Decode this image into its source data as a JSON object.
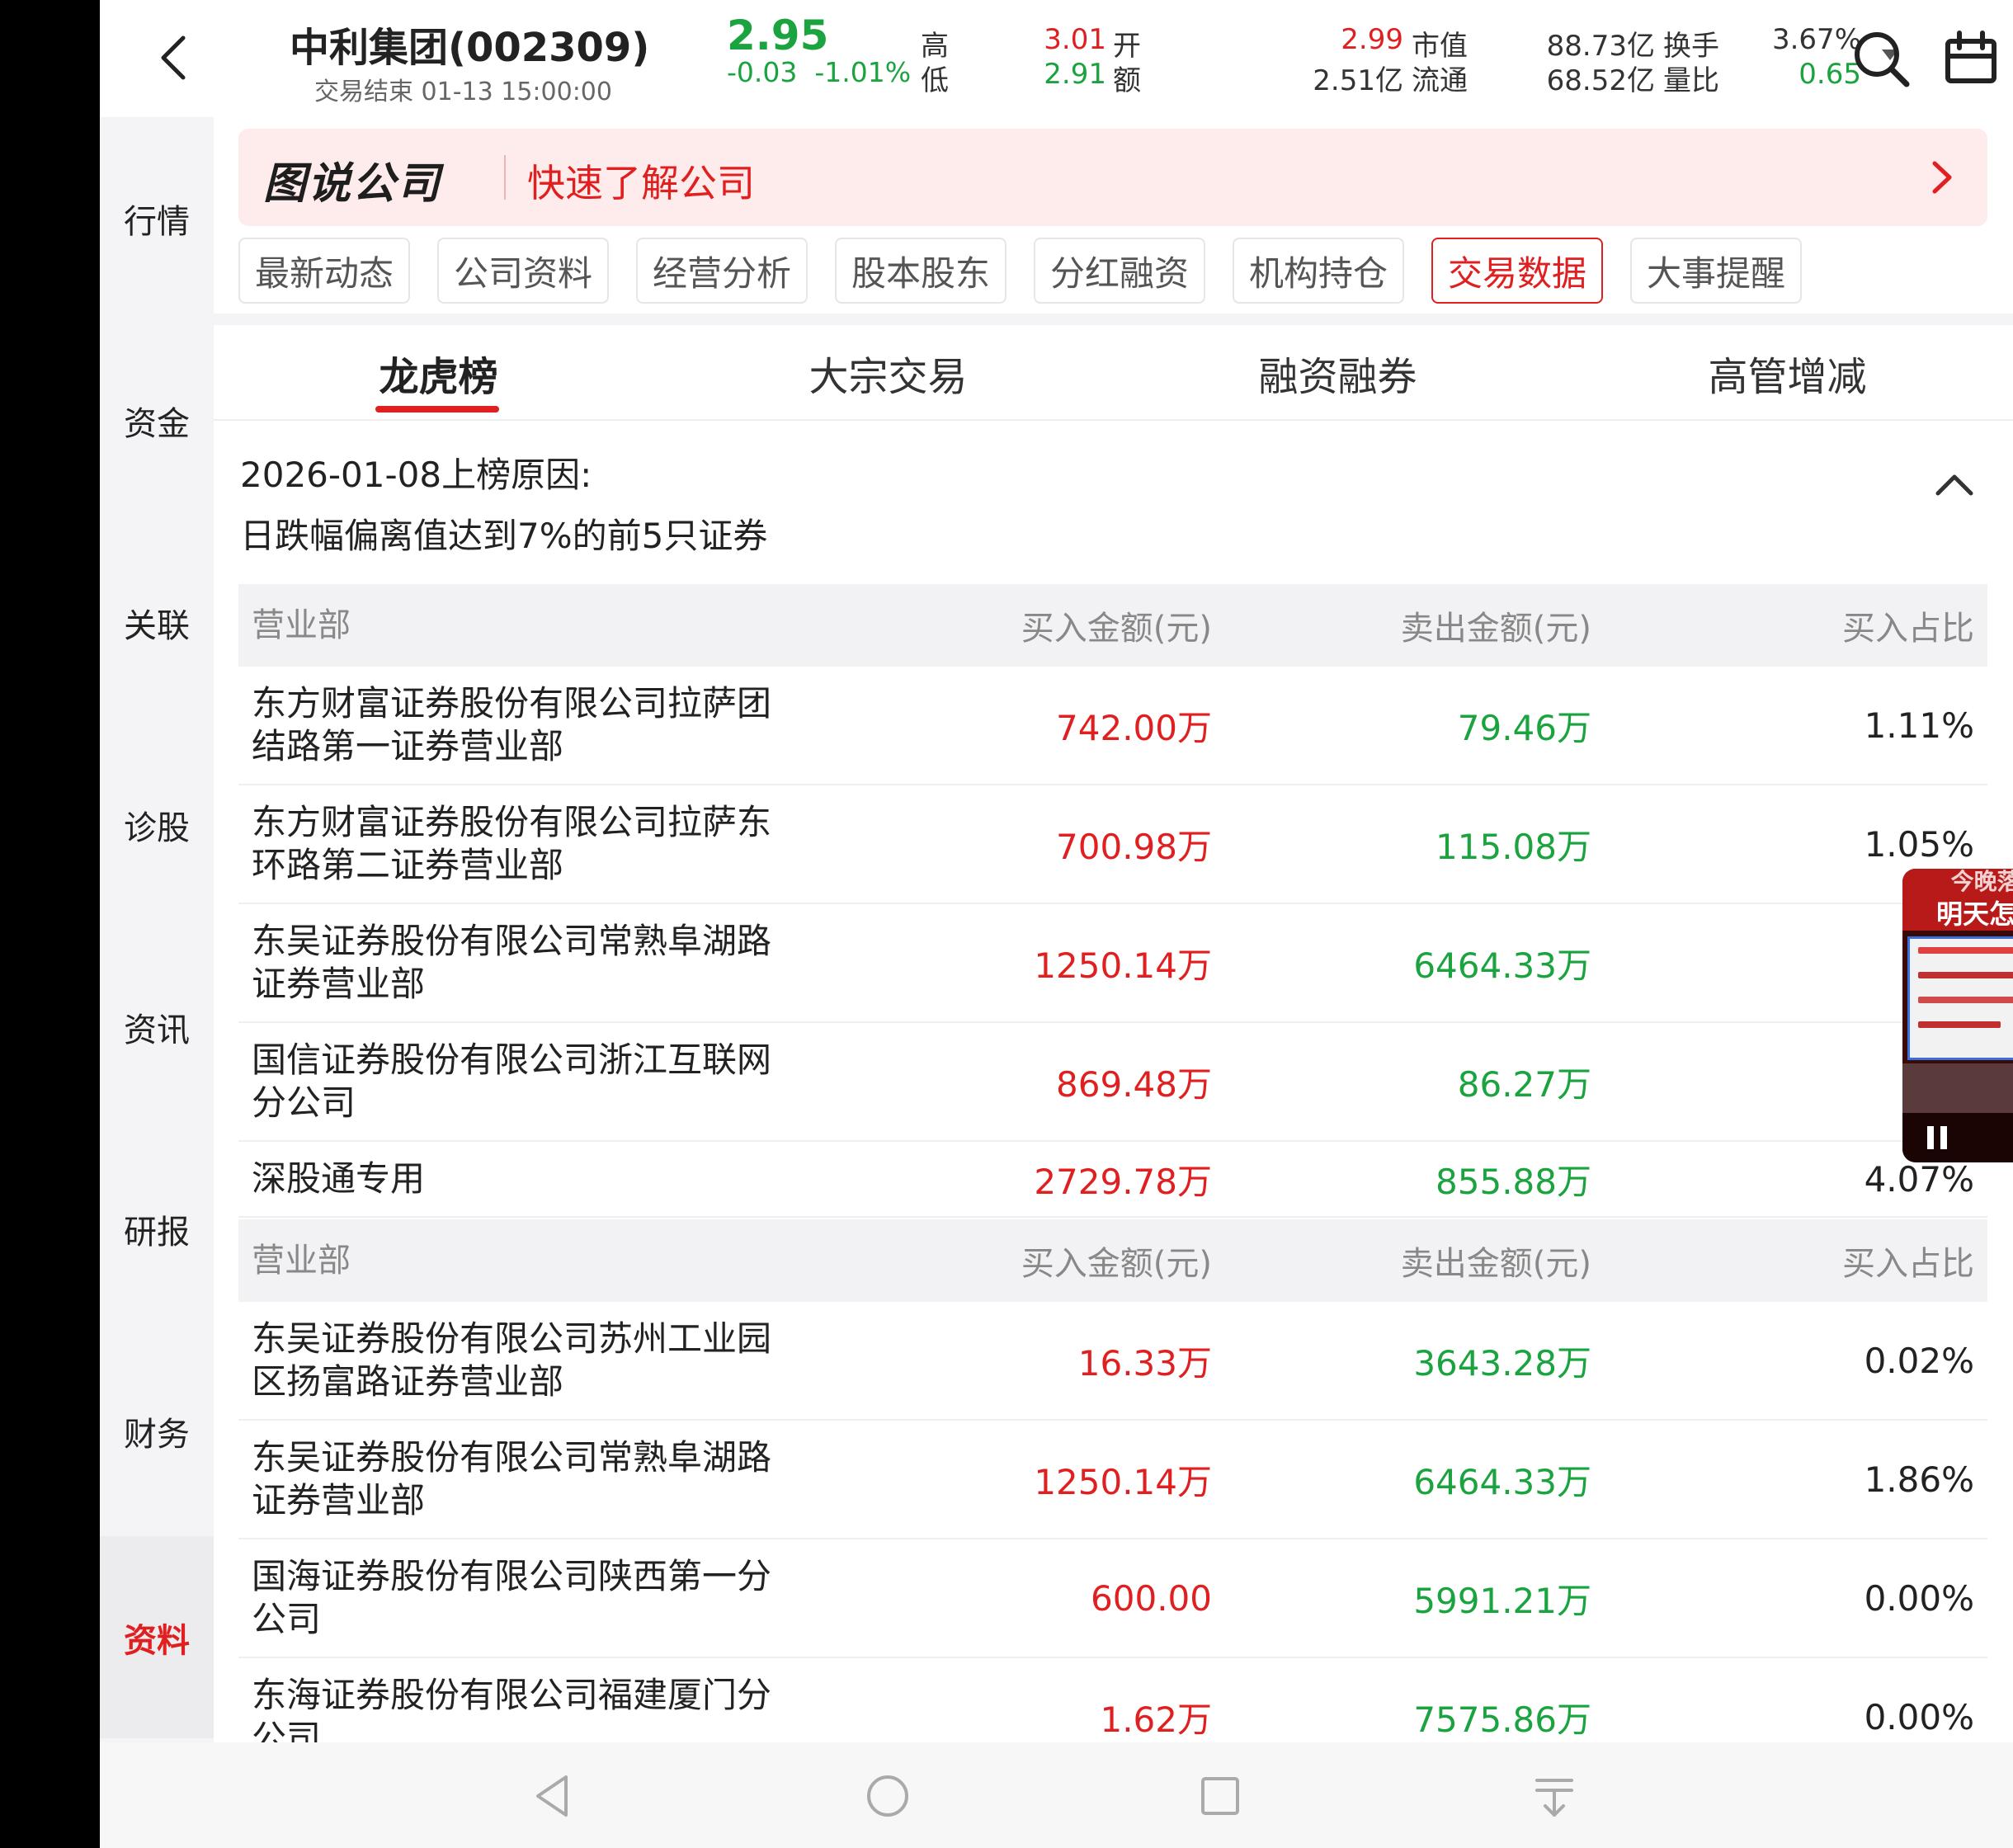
{
  "header": {
    "stock_name": "中利集团(002309)",
    "status": "交易结束 01-13 15:00:00",
    "price": "2.95",
    "change": "-0.03",
    "change_pct": "-1.01%",
    "stats": {
      "high_label": "高",
      "high": "3.01",
      "low_label": "低",
      "low": "2.91",
      "open_label": "开",
      "open": "2.99",
      "amount_label": "额",
      "amount": "2.51亿",
      "mktcap_label": "市值",
      "mktcap": "88.73亿",
      "float_label": "流通",
      "float": "68.52亿",
      "turnover_label": "换手",
      "turnover": "3.67%",
      "volratio_label": "量比",
      "volratio": "0.65"
    }
  },
  "left_nav": [
    {
      "label": "行情"
    },
    {
      "label": "资金"
    },
    {
      "label": "关联"
    },
    {
      "label": "诊股"
    },
    {
      "label": "资讯"
    },
    {
      "label": "研报"
    },
    {
      "label": "财务"
    },
    {
      "label": "资料"
    }
  ],
  "banner": {
    "logo": "图说公司",
    "text": "快速了解公司"
  },
  "category_tabs": [
    {
      "label": "最新动态"
    },
    {
      "label": "公司资料"
    },
    {
      "label": "经营分析"
    },
    {
      "label": "股本股东"
    },
    {
      "label": "分红融资"
    },
    {
      "label": "机构持仓"
    },
    {
      "label": "交易数据"
    },
    {
      "label": "大事提醒"
    }
  ],
  "sub_tabs": [
    {
      "label": "龙虎榜"
    },
    {
      "label": "大宗交易"
    },
    {
      "label": "融资融券"
    },
    {
      "label": "高管增减"
    }
  ],
  "reason": {
    "title": "2026-01-08上榜原因:",
    "text": "日跌幅偏离值达到7%的前5只证券"
  },
  "columns": {
    "name": "营业部",
    "buy": "买入金额(元)",
    "sell": "卖出金额(元)",
    "ratio": "买入占比"
  },
  "buy_table": [
    {
      "line1": "东方财富证券股份有限公司拉萨团",
      "line2": "结路第一证券营业部",
      "buy": "742.00万",
      "sell": "79.46万",
      "ratio": "1.11%"
    },
    {
      "line1": "东方财富证券股份有限公司拉萨东",
      "line2": "环路第二证券营业部",
      "buy": "700.98万",
      "sell": "115.08万",
      "ratio": "1.05%"
    },
    {
      "line1": "东吴证券股份有限公司常熟阜湖路",
      "line2": "证券营业部",
      "buy": "1250.14万",
      "sell": "6464.33万",
      "ratio": ""
    },
    {
      "line1": "国信证券股份有限公司浙江互联网",
      "line2": "分公司",
      "buy": "869.48万",
      "sell": "86.27万",
      "ratio": ""
    },
    {
      "line1": "深股通专用",
      "line2": "",
      "buy": "2729.78万",
      "sell": "855.88万",
      "ratio": "4.07%"
    }
  ],
  "sell_table": [
    {
      "line1": "东吴证券股份有限公司苏州工业园",
      "line2": "区扬富路证券营业部",
      "buy": "16.33万",
      "sell": "3643.28万",
      "ratio": "0.02%"
    },
    {
      "line1": "东吴证券股份有限公司常熟阜湖路",
      "line2": "证券营业部",
      "buy": "1250.14万",
      "sell": "6464.33万",
      "ratio": "1.86%"
    },
    {
      "line1": "国海证券股份有限公司陕西第一分",
      "line2": "公司",
      "buy": "600.00",
      "sell": "5991.21万",
      "ratio": "0.00%"
    },
    {
      "line1": "东海证券股份有限公司福建厦门分",
      "line2": "公司",
      "buy": "1.62万",
      "sell": "7575.86万",
      "ratio": "0.00%"
    }
  ],
  "video": {
    "title1": "今晚落地!",
    "title2": "明天怎么走"
  },
  "colors": {
    "up": "#e02020",
    "down": "#1aa33f",
    "accent": "#e02020"
  },
  "icons": {
    "back": "chevron-left-icon",
    "search": "search-icon",
    "menu": "portfolio-icon",
    "banner_arrow": "chevron-right-icon",
    "collapse": "chevron-up-icon",
    "pause": "pause-icon",
    "close": "close-icon",
    "sys_back": "triangle-back-icon",
    "sys_home": "circle-home-icon",
    "sys_recent": "square-recent-icon",
    "sys_extra": "download-icon"
  }
}
